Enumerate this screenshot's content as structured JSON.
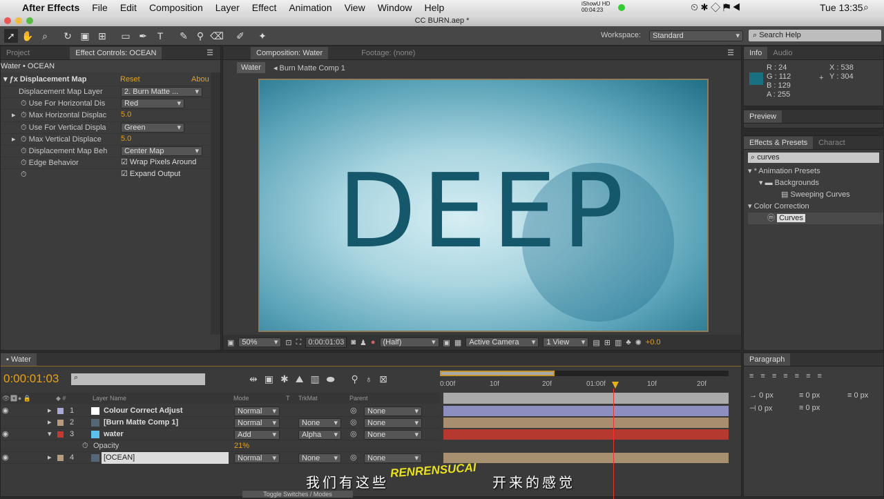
{
  "menubar": {
    "app": "After Effects",
    "items": [
      "File",
      "Edit",
      "Composition",
      "Layer",
      "Effect",
      "Animation",
      "View",
      "Window",
      "Help"
    ],
    "recorder": "iShowU HD",
    "recorder_time": "00:04:23",
    "clock": "Tue 13:35"
  },
  "title": "CC BURN.aep *",
  "toolbar": {
    "workspace_label": "Workspace:",
    "workspace_value": "Standard",
    "search_placeholder": "Search Help"
  },
  "left_panel": {
    "tabs": [
      "Project",
      "Effect Controls: OCEAN"
    ],
    "breadcrumb": "Water • OCEAN",
    "effect": {
      "name": "Displacement Map",
      "reset": "Reset",
      "about": "Abou"
    },
    "props": [
      {
        "label": "Displacement Map Layer",
        "value": "2. Burn Matte ...",
        "type": "dropdown"
      },
      {
        "label": "Use For Horizontal Dis",
        "value": "Red",
        "type": "dropdown"
      },
      {
        "label": "Max Horizontal Displac",
        "value": "5.0",
        "type": "number"
      },
      {
        "label": "Use For Vertical Displa",
        "value": "Green",
        "type": "dropdown"
      },
      {
        "label": "Max Vertical Displace",
        "value": "5.0",
        "type": "number"
      },
      {
        "label": "Displacement Map Beh",
        "value": "Center Map",
        "type": "dropdown"
      },
      {
        "label": "Edge Behavior",
        "value": "Wrap Pixels Around",
        "type": "checkbox"
      },
      {
        "label": "",
        "value": "Expand Output",
        "type": "checkbox"
      }
    ]
  },
  "comp": {
    "tabs": [
      "Composition: Water",
      "Footage: (none)"
    ],
    "crumbs": [
      "Water",
      "Burn Matte Comp 1"
    ],
    "text": "DEEP",
    "footer": {
      "zoom": "50%",
      "time": "0:00:01:03",
      "resolution": "(Half)",
      "camera": "Active Camera",
      "views": "1 View",
      "exposure": "+0.0"
    }
  },
  "info": {
    "tabs": [
      "Info",
      "Audio"
    ],
    "r": "R : 24",
    "g": "G : 112",
    "b": "B : 129",
    "a": "A : 255",
    "x": "X : 538",
    "y": "Y : 304",
    "swatch": "#187081"
  },
  "preview": {
    "tab": "Preview"
  },
  "effects": {
    "tabs": [
      "Effects & Presets",
      "Charact"
    ],
    "search": "curves",
    "tree": [
      "* Animation Presets",
      "Backgrounds",
      "Sweeping Curves",
      "Color Correction",
      "Curves"
    ]
  },
  "paragraph": {
    "tab": "Paragraph",
    "fields": [
      "0 px",
      "0 px",
      "0 px",
      "0 px",
      "0 px"
    ]
  },
  "timeline": {
    "tab": "Water",
    "time": "0:00:01:03",
    "headers": {
      "name": "Layer Name",
      "mode": "Mode",
      "t": "T",
      "trkmat": "TrkMat",
      "parent": "Parent"
    },
    "ruler": [
      "0:00f",
      "10f",
      "20f",
      "01:00f",
      "10f",
      "20f"
    ],
    "layers": [
      {
        "num": "1",
        "name": "Colour Correct Adjust",
        "mode": "Normal",
        "trkmat": "",
        "parent": "None",
        "label": "#a7a9d6",
        "bar": "#8d8fc0"
      },
      {
        "num": "2",
        "name": "[Burn Matte Comp 1]",
        "mode": "Normal",
        "trkmat": "None",
        "parent": "None",
        "label": "#b49c7c",
        "bar": "#a88e6f"
      },
      {
        "num": "3",
        "name": "water",
        "mode": "Add",
        "trkmat": "Alpha",
        "parent": "None",
        "label": "#c23a32",
        "bar": "#b5392e"
      },
      {
        "num": "4",
        "name": "[OCEAN]",
        "mode": "Normal",
        "trkmat": "None",
        "parent": "None",
        "label": "#b49c7c",
        "bar": "#a6906f"
      }
    ],
    "opacity_label": "Opacity",
    "opacity_value": "21%",
    "toggle": "Toggle Switches / Modes"
  },
  "subtitle": "我们有这些",
  "subtitle2": "开来的感觉",
  "watermark": "RENRENSUCAI.COM"
}
